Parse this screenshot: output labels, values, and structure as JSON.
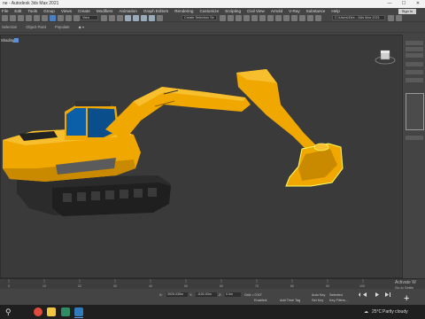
{
  "window": {
    "title": "ne - Autodesk 3ds Max 2021",
    "controls": [
      "—",
      "☐",
      "✕"
    ]
  },
  "menu": {
    "items": [
      "File",
      "Edit",
      "Tools",
      "Group",
      "Views",
      "Create",
      "Modifiers",
      "Animation",
      "Graph Editors",
      "Rendering",
      "Customize",
      "Scripting",
      "Civil View",
      "Arnold",
      "V-Ray",
      "Substance",
      "Help"
    ],
    "signin": "Sign In"
  },
  "toolbar": {
    "view_dropdown": "View",
    "selection_set": "Create Selection Se",
    "workspace": "C:\\Users\\Dire...\\3ds Max 2021"
  },
  "ribbon": {
    "tabs": [
      "Selection",
      "Object Paint",
      "Populate"
    ]
  },
  "viewport": {
    "label": "Shading ]"
  },
  "timeline": {
    "labels": [
      "0",
      "10",
      "20",
      "30",
      "40",
      "50",
      "60",
      "70",
      "80",
      "90",
      "100"
    ]
  },
  "status": {
    "x_label": "X:",
    "x_value": "3925.035m",
    "y_label": "Y:",
    "y_value": "-1152.53m",
    "z_label": "Z:",
    "z_value": "0.0m",
    "grid": "Grid = 0'10\"",
    "add_time_tag": "Add Time Tag",
    "enabled": "Enabled:",
    "auto_key": "Auto Key",
    "set_key": "Set Key",
    "selected": "Selected",
    "key_filters": "Key Filters...",
    "activate_title": "Activate W",
    "activate_sub": "Go to Settin"
  },
  "taskbar": {
    "temperature": "25°C",
    "weather": "Partly cloudy"
  },
  "colors": {
    "excavator_yellow": "#f0a800",
    "viewport_bg": "#3a3a3a",
    "selection_highlight": "#ffff66",
    "cab_blue": "#0b5fa8"
  }
}
